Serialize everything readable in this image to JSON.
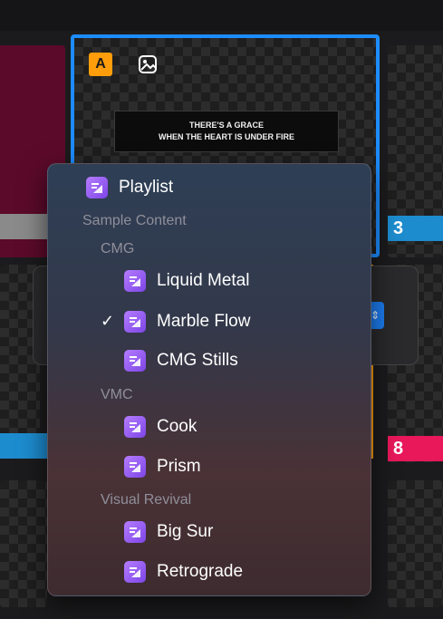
{
  "slide_active": {
    "badge_letter": "A",
    "lyric_line1": "THERE'S A GRACE",
    "lyric_line2": "WHEN THE HEART IS UNDER FIRE"
  },
  "slide_numbers": [
    "3",
    "8"
  ],
  "colors": {
    "selection_blue": "#1c8cff",
    "badge_orange": "#ff9d0a",
    "number_blue": "#1d8ccf",
    "number_pink": "#e8185b",
    "accent_purple": "#9b5cf6"
  },
  "menu": {
    "playlist": "Playlist",
    "header_sample": "Sample Content",
    "header_cmg": "CMG",
    "cmg_items": [
      "Liquid Metal",
      "Marble Flow",
      "CMG Stills"
    ],
    "header_vmc": "VMC",
    "vmc_items": [
      "Cook",
      "Prism"
    ],
    "header_revival": "Visual Revival",
    "revival_items": [
      "Big Sur",
      "Retrograde"
    ],
    "checked_item": "Marble Flow",
    "check_glyph": "✓",
    "item_icon": "playlist-media-icon"
  }
}
